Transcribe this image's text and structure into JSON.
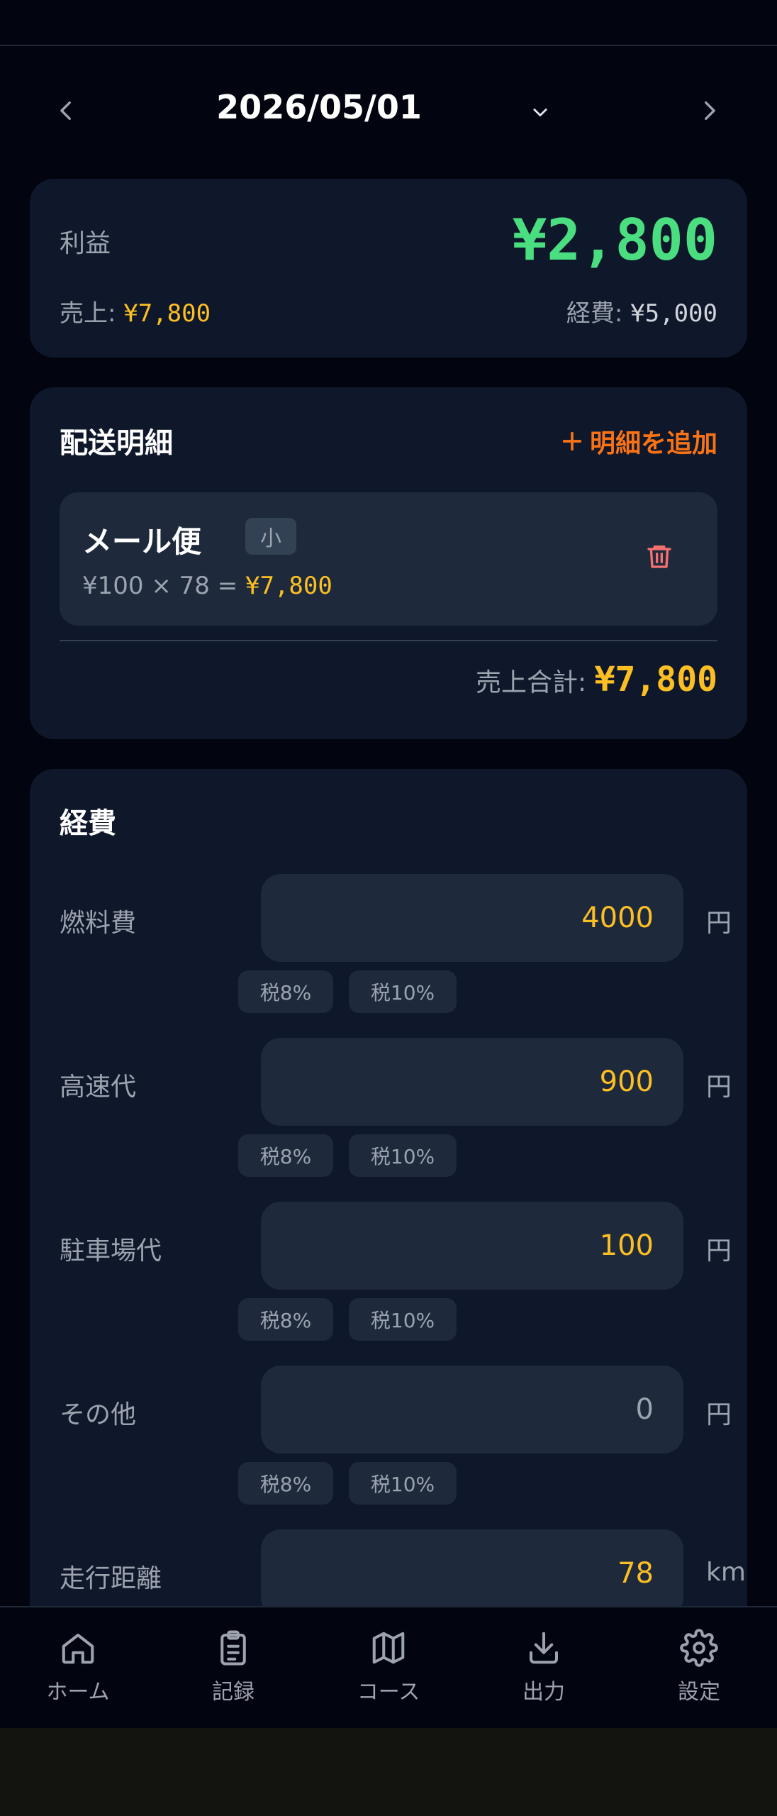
{
  "date_nav": {
    "date": "2026/05/01"
  },
  "summary": {
    "profit_label": "利益",
    "profit_value": "¥2,800",
    "sales_label": "売上: ",
    "sales_value": "¥7,800",
    "expense_label": "経費: ",
    "expense_value": "¥5,000"
  },
  "delivery": {
    "title": "配送明細",
    "add_label": "明細を追加",
    "items": [
      {
        "name": "メール便",
        "size": "小",
        "calc": "¥100 × 78 = ",
        "amount": "¥7,800"
      }
    ],
    "total_label": "売上合計: ",
    "total_value": "¥7,800"
  },
  "expenses": {
    "title": "経費",
    "unit_yen": "円",
    "unit_km": "km",
    "tax8": "税8%",
    "tax10": "税10%",
    "rows": [
      {
        "label": "燃料費",
        "value": "4000"
      },
      {
        "label": "高速代",
        "value": "900"
      },
      {
        "label": "駐車場代",
        "value": "100"
      },
      {
        "label": "その他",
        "value": "0"
      },
      {
        "label": "走行距離",
        "value": "78"
      }
    ]
  },
  "bottom_nav": [
    {
      "label": "ホーム",
      "icon": "home-icon"
    },
    {
      "label": "記録",
      "icon": "clipboard-icon"
    },
    {
      "label": "コース",
      "icon": "map-icon"
    },
    {
      "label": "出力",
      "icon": "download-icon"
    },
    {
      "label": "設定",
      "icon": "gear-icon"
    }
  ],
  "colors": {
    "background": "#02050f",
    "card": "#0f172a",
    "profit": "#4ade80",
    "amount": "#fbbf24",
    "accent": "#f97316",
    "danger": "#f87171"
  }
}
